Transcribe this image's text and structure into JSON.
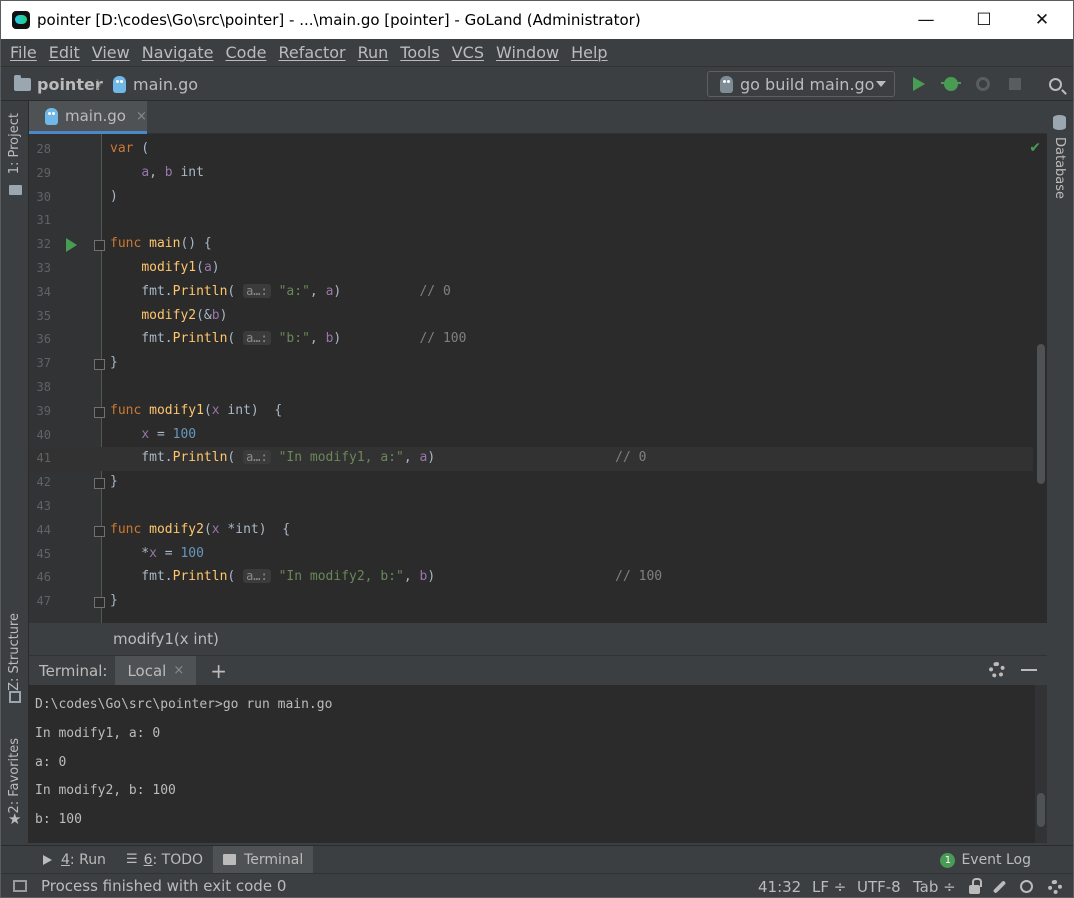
{
  "window": {
    "title": "pointer [D:\\codes\\Go\\src\\pointer] - ...\\main.go [pointer] - GoLand (Administrator)",
    "minimize": "—",
    "maximize": "☐",
    "close": "✕"
  },
  "menu": [
    "File",
    "Edit",
    "View",
    "Navigate",
    "Code",
    "Refactor",
    "Run",
    "Tools",
    "VCS",
    "Window",
    "Help"
  ],
  "breadcrumb": {
    "project": "pointer",
    "separator": "〉",
    "file": "main.go"
  },
  "run_config": {
    "label": "go build main.go"
  },
  "left_tools": {
    "project": "1: Project",
    "structure": "Z: Structure",
    "favorites": "2: Favorites"
  },
  "right_tools": {
    "database": "Database"
  },
  "editor_tab": {
    "label": "main.go",
    "close": "×"
  },
  "code": {
    "lines": [
      {
        "n": "28",
        "parts": [
          [
            "kw",
            "var"
          ],
          [
            "p",
            " ("
          ]
        ]
      },
      {
        "n": "29",
        "parts": [
          [
            "p",
            "    "
          ],
          [
            "var",
            "a"
          ],
          [
            "p",
            ", "
          ],
          [
            "var",
            "b"
          ],
          [
            "p",
            " int"
          ]
        ]
      },
      {
        "n": "30",
        "parts": [
          [
            "p",
            ")"
          ]
        ]
      },
      {
        "n": "31",
        "parts": []
      },
      {
        "n": "32",
        "parts": [
          [
            "kw",
            "func "
          ],
          [
            "fn",
            "main"
          ],
          [
            "p",
            "() {"
          ]
        ],
        "run": true,
        "fold": true
      },
      {
        "n": "33",
        "parts": [
          [
            "p",
            "    "
          ],
          [
            "fn",
            "modify1"
          ],
          [
            "p",
            "("
          ],
          [
            "var",
            "a"
          ],
          [
            "p",
            ")"
          ]
        ]
      },
      {
        "n": "34",
        "parts": [
          [
            "p",
            "    fmt."
          ],
          [
            "fn",
            "Println"
          ],
          [
            "p",
            "( "
          ],
          [
            "hint",
            "a…:"
          ],
          [
            "p",
            " "
          ],
          [
            "str",
            "\"a:\""
          ],
          [
            "p",
            ", "
          ],
          [
            "var",
            "a"
          ],
          [
            "p",
            ")          "
          ],
          [
            "cmt",
            "// 0"
          ]
        ]
      },
      {
        "n": "35",
        "parts": [
          [
            "p",
            "    "
          ],
          [
            "fn",
            "modify2"
          ],
          [
            "p",
            "(&"
          ],
          [
            "var",
            "b"
          ],
          [
            "p",
            ")"
          ]
        ]
      },
      {
        "n": "36",
        "parts": [
          [
            "p",
            "    fmt."
          ],
          [
            "fn",
            "Println"
          ],
          [
            "p",
            "( "
          ],
          [
            "hint",
            "a…:"
          ],
          [
            "p",
            " "
          ],
          [
            "str",
            "\"b:\""
          ],
          [
            "p",
            ", "
          ],
          [
            "var",
            "b"
          ],
          [
            "p",
            ")          "
          ],
          [
            "cmt",
            "// 100"
          ]
        ]
      },
      {
        "n": "37",
        "parts": [
          [
            "p",
            "}"
          ]
        ],
        "fold": true
      },
      {
        "n": "38",
        "parts": []
      },
      {
        "n": "39",
        "parts": [
          [
            "kw",
            "func "
          ],
          [
            "fn",
            "modify1"
          ],
          [
            "p",
            "("
          ],
          [
            "var",
            "x"
          ],
          [
            "p",
            " int)  {"
          ]
        ],
        "fold": true
      },
      {
        "n": "40",
        "parts": [
          [
            "p",
            "    "
          ],
          [
            "var",
            "x"
          ],
          [
            "p",
            " = "
          ],
          [
            "num",
            "100"
          ]
        ]
      },
      {
        "n": "41",
        "parts": [
          [
            "p",
            "    fmt."
          ],
          [
            "fn",
            "Println"
          ],
          [
            "p",
            "( "
          ],
          [
            "hint",
            "a…:"
          ],
          [
            "p",
            " "
          ],
          [
            "str",
            "\"In modify1, a:\""
          ],
          [
            "p",
            ", "
          ],
          [
            "var",
            "a"
          ],
          [
            "p",
            ")                       "
          ],
          [
            "cmt",
            "// 0"
          ]
        ],
        "current": true
      },
      {
        "n": "42",
        "parts": [
          [
            "p",
            "}"
          ]
        ],
        "fold": true
      },
      {
        "n": "43",
        "parts": []
      },
      {
        "n": "44",
        "parts": [
          [
            "kw",
            "func "
          ],
          [
            "fn",
            "modify2"
          ],
          [
            "p",
            "("
          ],
          [
            "var",
            "x"
          ],
          [
            "p",
            " *int)  {"
          ]
        ],
        "fold": true
      },
      {
        "n": "45",
        "parts": [
          [
            "p",
            "    *"
          ],
          [
            "var",
            "x"
          ],
          [
            "p",
            " = "
          ],
          [
            "num",
            "100"
          ]
        ]
      },
      {
        "n": "46",
        "parts": [
          [
            "p",
            "    fmt."
          ],
          [
            "fn",
            "Println"
          ],
          [
            "p",
            "( "
          ],
          [
            "hint",
            "a…:"
          ],
          [
            "p",
            " "
          ],
          [
            "str",
            "\"In modify2, b:\""
          ],
          [
            "p",
            ", "
          ],
          [
            "var",
            "b"
          ],
          [
            "p",
            ")                       "
          ],
          [
            "cmt",
            "// 100"
          ]
        ]
      },
      {
        "n": "47",
        "parts": [
          [
            "p",
            "}"
          ]
        ],
        "fold": true
      }
    ]
  },
  "code_breadcrumb": "modify1(x int)",
  "terminal": {
    "title": "Terminal:",
    "tab": "Local",
    "tab_close": "×",
    "add": "+",
    "lines": [
      "D:\\codes\\Go\\src\\pointer>go run main.go",
      "In modify1, a: 0",
      "a: 0",
      "In modify2, b: 100",
      "b: 100"
    ]
  },
  "tool_windows": {
    "run": {
      "key": "4",
      "label": ": Run"
    },
    "todo": {
      "key": "6",
      "label": ": TODO"
    },
    "terminal": {
      "label": "Terminal"
    },
    "event_log": {
      "badge": "1",
      "label": "Event Log"
    }
  },
  "status": {
    "message": "Process finished with exit code 0",
    "position": "41:32",
    "line_sep": "LF ÷",
    "encoding": "UTF-8",
    "indent": "Tab ÷"
  },
  "colors": {
    "run_green": "#499c54",
    "tab_accent": "#4a88c7",
    "editor_bg": "#2b2b2b"
  }
}
